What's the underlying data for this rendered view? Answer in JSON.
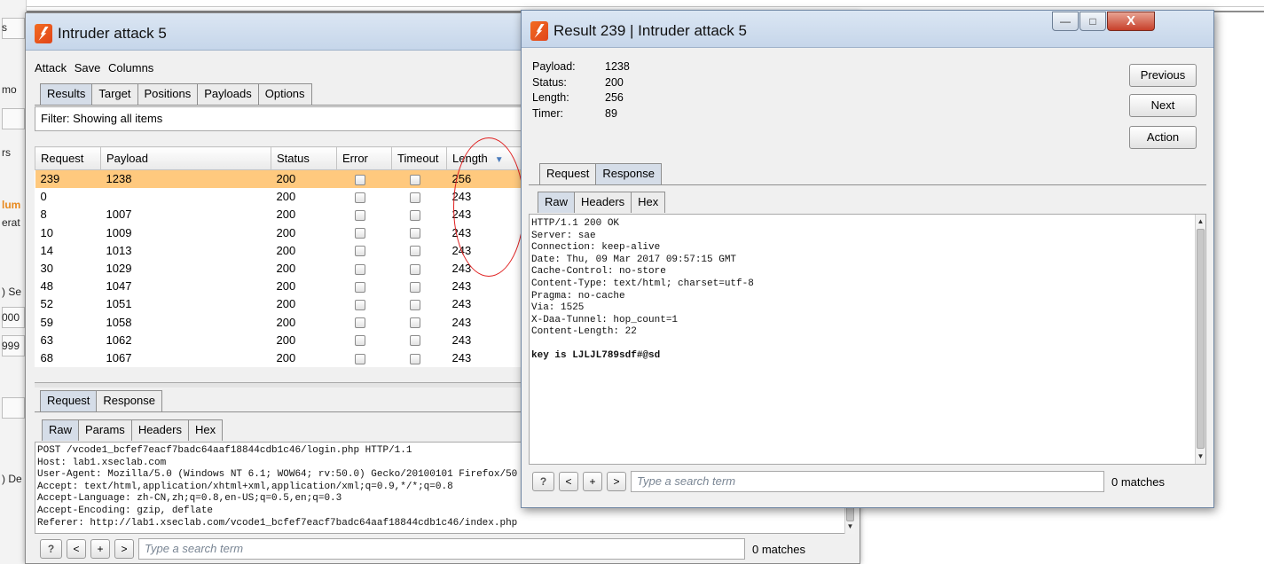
{
  "background": {
    "fragments": [
      "s",
      "mo",
      "rs",
      "lum",
      "erat",
      ") Se",
      "000",
      "999",
      ") De"
    ]
  },
  "main_window": {
    "title": "Intruder attack 5",
    "menu": [
      "Attack",
      "Save",
      "Columns"
    ],
    "tabs": [
      "Results",
      "Target",
      "Positions",
      "Payloads",
      "Options"
    ],
    "active_tab": "Results",
    "filter_text": "Filter: Showing all items",
    "table": {
      "columns": [
        "Request",
        "Payload",
        "Status",
        "Error",
        "Timeout",
        "Length"
      ],
      "rows": [
        {
          "request": "239",
          "payload": "1238",
          "status": "200",
          "length": "256",
          "selected": true
        },
        {
          "request": "0",
          "payload": "",
          "status": "200",
          "length": "243"
        },
        {
          "request": "8",
          "payload": "1007",
          "status": "200",
          "length": "243"
        },
        {
          "request": "10",
          "payload": "1009",
          "status": "200",
          "length": "243"
        },
        {
          "request": "14",
          "payload": "1013",
          "status": "200",
          "length": "243"
        },
        {
          "request": "30",
          "payload": "1029",
          "status": "200",
          "length": "243"
        },
        {
          "request": "48",
          "payload": "1047",
          "status": "200",
          "length": "243"
        },
        {
          "request": "52",
          "payload": "1051",
          "status": "200",
          "length": "243"
        },
        {
          "request": "59",
          "payload": "1058",
          "status": "200",
          "length": "243"
        },
        {
          "request": "63",
          "payload": "1062",
          "status": "200",
          "length": "243"
        },
        {
          "request": "68",
          "payload": "1067",
          "status": "200",
          "length": "243"
        }
      ]
    },
    "req_resp_tabs": [
      "Request",
      "Response"
    ],
    "sub_tabs": [
      "Raw",
      "Params",
      "Headers",
      "Hex"
    ],
    "request_lines": [
      "POST /vcode1_bcfef7eacf7badc64aaf18844cdb1c46/login.php HTTP/1.1",
      "Host: lab1.xseclab.com",
      "User-Agent: Mozilla/5.0 (Windows NT 6.1; WOW64; rv:50.0) Gecko/20100101 Firefox/50",
      "Accept: text/html,application/xhtml+xml,application/xml;q=0.9,*/*;q=0.8",
      "Accept-Language: zh-CN,zh;q=0.8,en-US;q=0.5,en;q=0.3",
      "Accept-Encoding: gzip, deflate",
      "Referer: http://lab1.xseclab.com/vcode1_bcfef7eacf7badc64aaf18844cdb1c46/index.php"
    ],
    "search": {
      "buttons": [
        "?",
        "<",
        "+",
        ">"
      ],
      "placeholder": "Type a search term",
      "matches": "0 matches"
    }
  },
  "result_window": {
    "title": "Result 239 | Intruder attack 5",
    "controls": {
      "minimize": "—",
      "maximize": "□",
      "close": "X"
    },
    "info": [
      {
        "label": "Payload:",
        "value": "1238"
      },
      {
        "label": "Status:",
        "value": "200"
      },
      {
        "label": "Length:",
        "value": "256"
      },
      {
        "label": "Timer:",
        "value": "89"
      }
    ],
    "buttons": {
      "previous": "Previous",
      "next": "Next",
      "action": "Action"
    },
    "tabs": [
      "Request",
      "Response"
    ],
    "sub_tabs": [
      "Raw",
      "Headers",
      "Hex"
    ],
    "response_lines": [
      "HTTP/1.1 200 OK",
      "Server: sae",
      "Connection: keep-alive",
      "Date: Thu, 09 Mar 2017 09:57:15 GMT",
      "Cache-Control: no-store",
      "Content-Type: text/html; charset=utf-8",
      "Pragma: no-cache",
      "Via: 1525",
      "X-Daa-Tunnel: hop_count=1",
      "Content-Length: 22"
    ],
    "response_body": "key is LJLJL789sdf#@sd",
    "search": {
      "buttons": [
        "?",
        "<",
        "+",
        ">"
      ],
      "placeholder": "Type a search term",
      "matches": "0 matches"
    }
  },
  "colors": {
    "selected_row": "#ffc97e",
    "annotation_circle": "#e02020",
    "burp_orange": "#f26b21"
  }
}
